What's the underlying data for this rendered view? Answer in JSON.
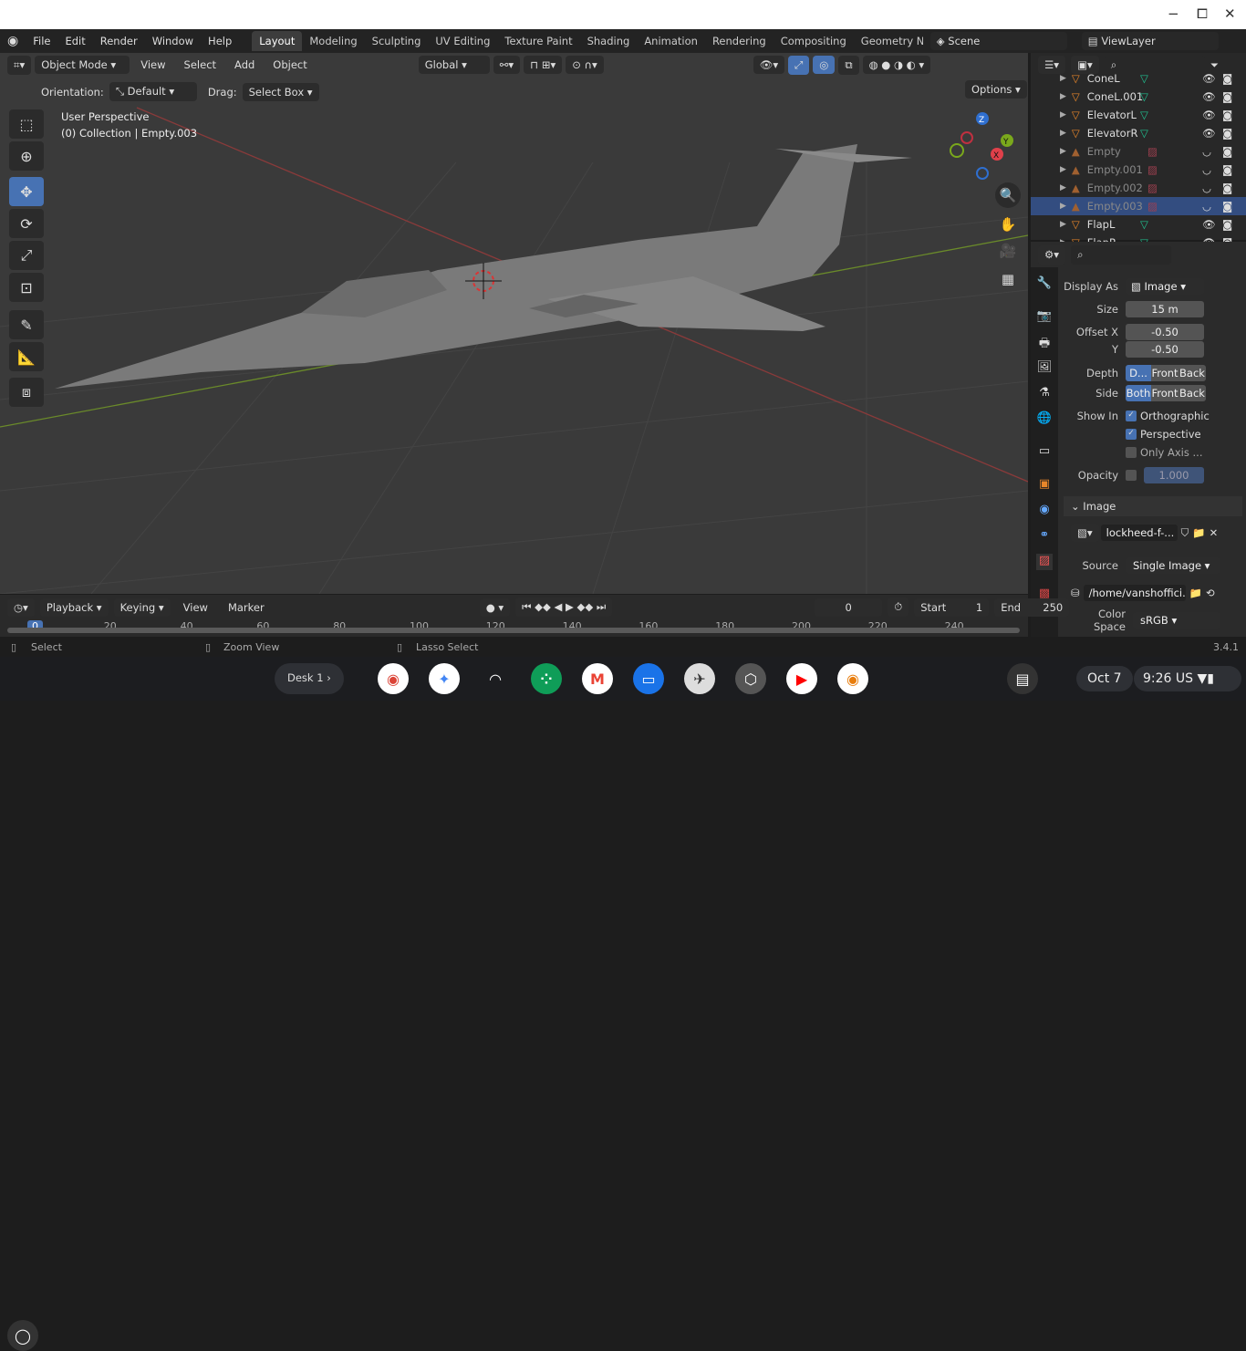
{
  "window": {
    "minimize": "−",
    "maximize": "⧠",
    "close": "✕"
  },
  "menus": [
    "File",
    "Edit",
    "Render",
    "Window",
    "Help"
  ],
  "workspaces": [
    "Layout",
    "Modeling",
    "Sculpting",
    "UV Editing",
    "Texture Paint",
    "Shading",
    "Animation",
    "Rendering",
    "Compositing",
    "Geometry Noc"
  ],
  "scene": "Scene",
  "view_layer": "ViewLayer",
  "viewport": {
    "mode": "Object Mode",
    "menus": [
      "View",
      "Select",
      "Add",
      "Object"
    ],
    "transform": "Global",
    "orientation_label": "Orientation:",
    "orientation": "Default",
    "drag_label": "Drag:",
    "drag": "Select Box",
    "options": "Options",
    "info_line1": "User Perspective",
    "info_line2": "(0) Collection | Empty.003",
    "gizmo": {
      "x": "X",
      "y": "Y",
      "z": "Z"
    }
  },
  "outliner": {
    "rows": [
      {
        "name": "ConeL",
        "type": "mesh",
        "dim": false,
        "sel": false
      },
      {
        "name": "ConeL.001",
        "type": "mesh",
        "dim": false,
        "sel": false
      },
      {
        "name": "ElevatorL",
        "type": "mesh",
        "dim": false,
        "sel": false
      },
      {
        "name": "ElevatorR",
        "type": "mesh",
        "dim": false,
        "sel": false
      },
      {
        "name": "Empty",
        "type": "image",
        "dim": true,
        "sel": false
      },
      {
        "name": "Empty.001",
        "type": "image",
        "dim": true,
        "sel": false
      },
      {
        "name": "Empty.002",
        "type": "image",
        "dim": true,
        "sel": false
      },
      {
        "name": "Empty.003",
        "type": "image",
        "dim": true,
        "sel": true
      },
      {
        "name": "FlapL",
        "type": "mesh",
        "dim": false,
        "sel": false
      },
      {
        "name": "FlapR",
        "type": "mesh",
        "dim": false,
        "sel": false
      }
    ]
  },
  "properties": {
    "display_as_label": "Display As",
    "display_as": "Image",
    "size_label": "Size",
    "size": "15 m",
    "offset_x_label": "Offset X",
    "offset_x": "-0.50",
    "offset_y_label": "Y",
    "offset_y": "-0.50",
    "depth_label": "Depth",
    "depth_opts": [
      "D...",
      "Front",
      "Back"
    ],
    "side_label": "Side",
    "side_opts": [
      "Both",
      "Front",
      "Back"
    ],
    "show_in_label": "Show In",
    "orthographic": "Orthographic",
    "perspective": "Perspective",
    "only_axis": "Only Axis ...",
    "opacity_label": "Opacity",
    "opacity": "1.000",
    "image_panel": "Image",
    "image_name": "lockheed-f-...",
    "source_label": "Source",
    "source": "Single Image",
    "filepath": "/home/vanshoffici...",
    "color_space_label": "Color Space",
    "color_space": "sRGB"
  },
  "timeline": {
    "playback": "Playback",
    "keying": "Keying",
    "view": "View",
    "marker": "Marker",
    "current_frame": "0",
    "start_label": "Start",
    "start": "1",
    "end_label": "End",
    "end": "250",
    "ticks": [
      "0",
      "20",
      "40",
      "60",
      "80",
      "100",
      "120",
      "140",
      "160",
      "180",
      "200",
      "220",
      "240"
    ]
  },
  "status": {
    "select": "Select",
    "zoom": "Zoom View",
    "lasso": "Lasso Select",
    "version": "3.4.1"
  },
  "shelf": {
    "desk": "Desk 1",
    "date": "Oct 7",
    "time": "9:26",
    "locale": "US"
  }
}
